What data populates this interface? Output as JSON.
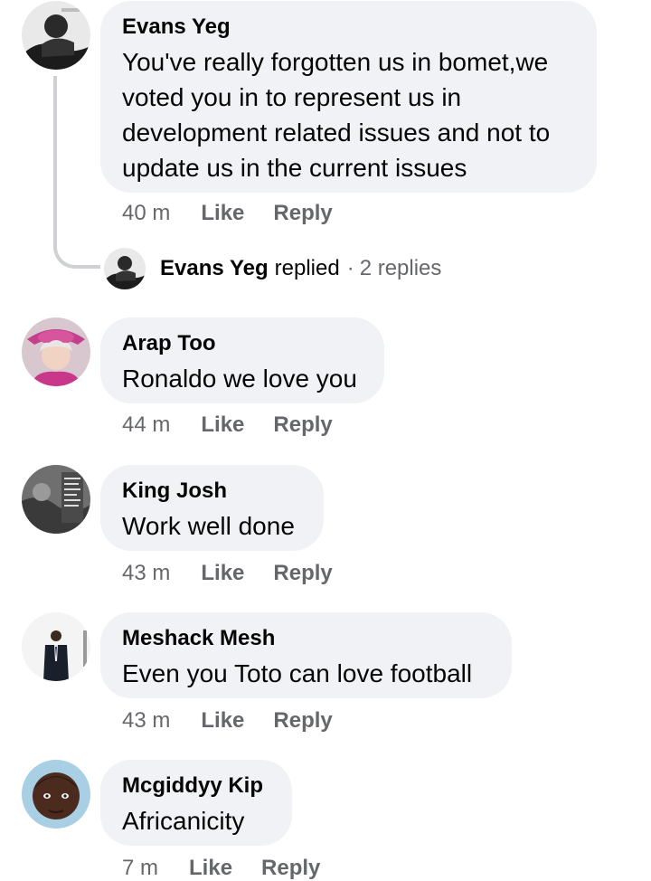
{
  "comments": [
    {
      "author": "Evans Yeg",
      "text": "You've really forgotten us in bomet,we voted you in to represent us in development related issues and not to update us in the current issues",
      "time": "40 m",
      "like": "Like",
      "reply": "Reply"
    },
    {
      "author": "Arap Too",
      "text": "Ronaldo we love you",
      "time": "44 m",
      "like": "Like",
      "reply": "Reply"
    },
    {
      "author": "King Josh",
      "text": "Work well done",
      "time": "43 m",
      "like": "Like",
      "reply": "Reply"
    },
    {
      "author": "Meshack Mesh",
      "text": "Even you Toto can love football",
      "time": "43 m",
      "like": "Like",
      "reply": "Reply"
    },
    {
      "author": "Mcgiddyy Kip",
      "text": "Africanicity",
      "time": "7 m",
      "like": "Like",
      "reply": "Reply"
    }
  ],
  "replied_summary": {
    "name": "Evans Yeg",
    "word": "replied",
    "separator": "·",
    "count": "2 replies"
  },
  "colors": {
    "bubble": "#f0f2f5",
    "meta_text": "#65676b",
    "thread_line": "#ced0d4"
  },
  "icons": {
    "avatar_evans": "profile-photo",
    "avatar_arap": "profile-photo",
    "avatar_king": "profile-photo",
    "avatar_meshack": "profile-photo",
    "avatar_mcgiddyy": "profile-photo"
  }
}
